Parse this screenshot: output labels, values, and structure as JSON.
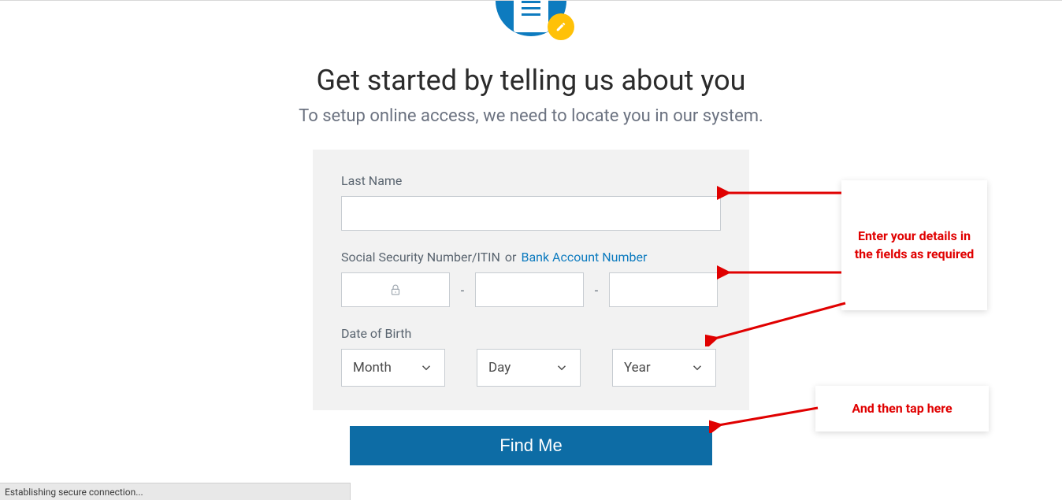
{
  "header_icon": {
    "main": "clipboard-icon",
    "badge": "pencil-icon"
  },
  "heading": "Get started by telling us about you",
  "subheading": "To setup online access, we need to locate you in our system.",
  "form": {
    "last_name_label": "Last Name",
    "last_name_value": "",
    "ssn_label": "Social Security Number/ITIN",
    "or_text": "or",
    "bank_link": "Bank Account Number",
    "ssn_locked_icon": "lock-icon",
    "ssn_dash": "-",
    "dob_label": "Date of Birth",
    "month_placeholder": "Month",
    "day_placeholder": "Day",
    "year_placeholder": "Year"
  },
  "submit_label": "Find Me",
  "annotations": {
    "box1": "Enter your details in the fields as required",
    "box2": "And then tap here"
  },
  "status_bar": "Establishing secure connection...",
  "colors": {
    "primary": "#0d7bbf",
    "button": "#0d6ca5",
    "panel": "#f2f2f2",
    "annotation_red": "#e00000",
    "badge_yellow": "#ffc107"
  }
}
